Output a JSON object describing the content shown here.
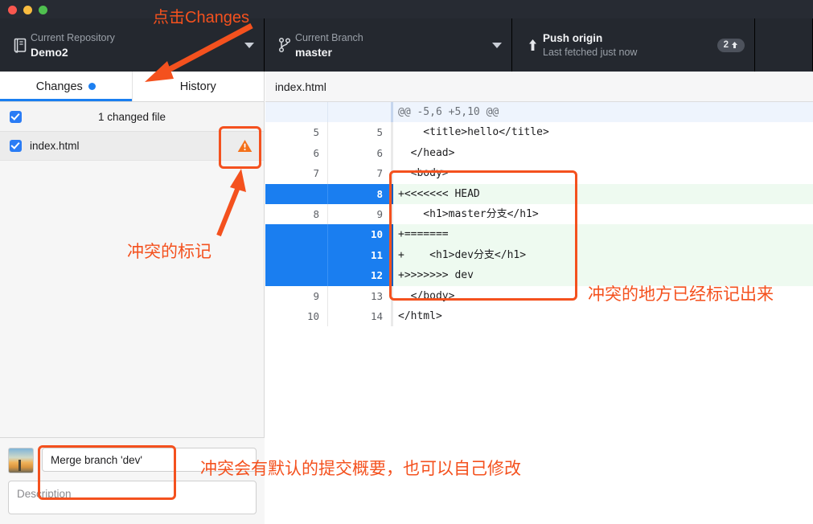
{
  "window": {
    "traffic_lights": [
      "close",
      "minimize",
      "maximize"
    ]
  },
  "toolbar": {
    "repository": {
      "label": "Current Repository",
      "value": "Demo2",
      "icon": "repo-icon",
      "caret": "chevron-down-icon"
    },
    "branch": {
      "label": "Current Branch",
      "value": "master",
      "icon": "branch-icon",
      "caret": "chevron-down-icon"
    },
    "push": {
      "title": "Push origin",
      "subtitle": "Last fetched just now",
      "icon": "arrow-up-icon",
      "badge_count": "2",
      "badge_icon": "arrow-up-small-icon"
    }
  },
  "sidebar": {
    "tabs": [
      {
        "label": "Changes",
        "active": true,
        "has_dot": true
      },
      {
        "label": "History",
        "active": false,
        "has_dot": false
      }
    ],
    "changed_header": {
      "label": "1 changed file",
      "checked": true
    },
    "files": [
      {
        "name": "index.html",
        "checked": true,
        "status_icon": "warning-triangle-icon"
      }
    ],
    "commit": {
      "summary_value": "Merge branch 'dev'",
      "description_placeholder": "Description",
      "avatar": "user-avatar"
    }
  },
  "diff": {
    "file_header": "index.html",
    "lines": [
      {
        "type": "hunk",
        "old": "",
        "new": "",
        "text": "@@ -5,6 +5,10 @@"
      },
      {
        "type": "ctx",
        "old": "5",
        "new": "5",
        "text": "    <title>hello</title>"
      },
      {
        "type": "ctx",
        "old": "6",
        "new": "6",
        "text": "  </head>"
      },
      {
        "type": "ctx",
        "old": "7",
        "new": "7",
        "text": "  <body>"
      },
      {
        "type": "add",
        "old": "",
        "new": "8",
        "text": "+<<<<<<< HEAD"
      },
      {
        "type": "ctx",
        "old": "8",
        "new": "9",
        "text": "    <h1>master分支</h1>"
      },
      {
        "type": "add",
        "old": "",
        "new": "10",
        "text": "+======="
      },
      {
        "type": "add",
        "old": "",
        "new": "11",
        "text": "+    <h1>dev分支</h1>"
      },
      {
        "type": "add",
        "old": "",
        "new": "12",
        "text": "+>>>>>>> dev"
      },
      {
        "type": "ctx",
        "old": "9",
        "new": "13",
        "text": "  </body>"
      },
      {
        "type": "ctx",
        "old": "10",
        "new": "14",
        "text": "</html>"
      }
    ]
  },
  "annotations": {
    "click_changes": "点击Changes",
    "conflict_marker": "冲突的标记",
    "conflict_marked_here": "冲突的地方已经标记出来",
    "default_commit_summary": "冲突会有默认的提交概要，也可以自己修改"
  },
  "colors": {
    "accent_blue": "#1a7ef0",
    "annotation_orange": "#f4511e",
    "warning_orange": "#f4711a",
    "toolbar_dark": "#24282f",
    "added_line_bg": "#eefaf0"
  }
}
